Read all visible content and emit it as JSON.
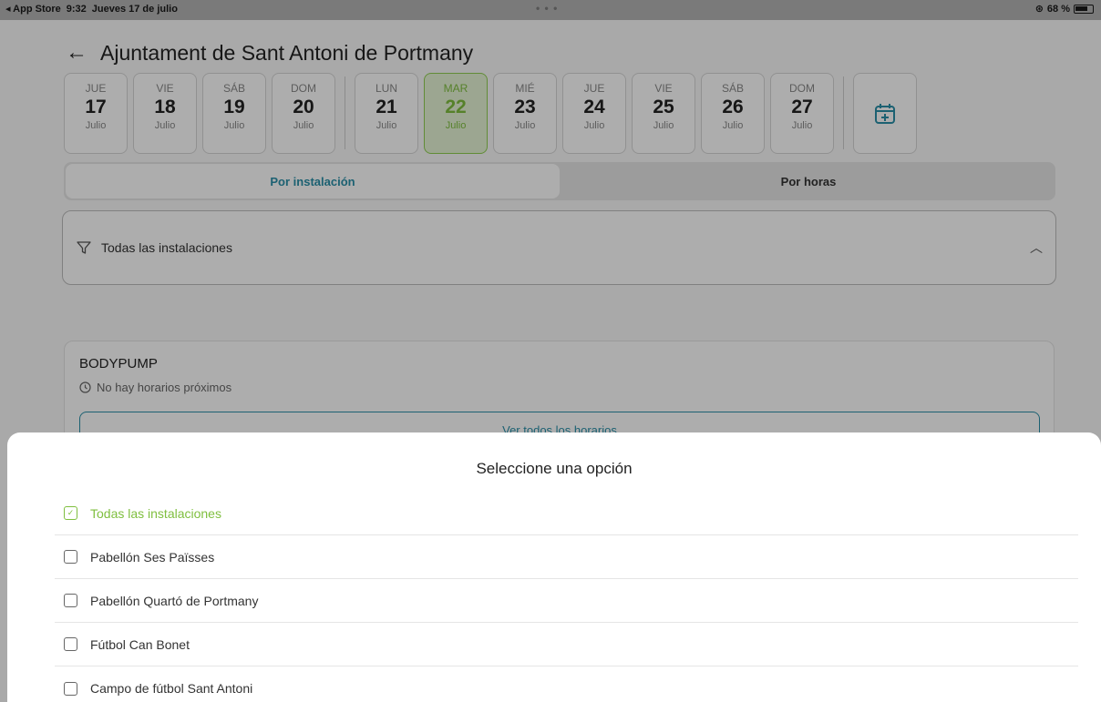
{
  "status_bar": {
    "back_app": "◂ App Store",
    "time": "9:32",
    "date": "Jueves 17 de julio",
    "battery": "68 %"
  },
  "header": {
    "title": "Ajuntament de Sant Antoni de Portmany"
  },
  "days_group1": [
    {
      "weekday": "JUE",
      "day": "17",
      "month": "Julio"
    },
    {
      "weekday": "VIE",
      "day": "18",
      "month": "Julio"
    },
    {
      "weekday": "SÁB",
      "day": "19",
      "month": "Julio"
    },
    {
      "weekday": "DOM",
      "day": "20",
      "month": "Julio"
    }
  ],
  "days_group2": [
    {
      "weekday": "LUN",
      "day": "21",
      "month": "Julio"
    },
    {
      "weekday": "MAR",
      "day": "22",
      "month": "Julio",
      "selected": true
    },
    {
      "weekday": "MIÉ",
      "day": "23",
      "month": "Julio"
    },
    {
      "weekday": "JUE",
      "day": "24",
      "month": "Julio"
    },
    {
      "weekday": "VIE",
      "day": "25",
      "month": "Julio"
    },
    {
      "weekday": "SÁB",
      "day": "26",
      "month": "Julio"
    },
    {
      "weekday": "DOM",
      "day": "27",
      "month": "Julio"
    }
  ],
  "tabs": {
    "by_facility": "Por instalación",
    "by_hours": "Por horas"
  },
  "filter": {
    "label": "Todas las instalaciones"
  },
  "card": {
    "name": "BODYPUMP",
    "schedule_note": "No hay horarios próximos",
    "see_all": "Ver todos los horarios"
  },
  "sheet": {
    "title": "Seleccione una opción",
    "options": [
      {
        "label": "Todas las instalaciones",
        "checked": true
      },
      {
        "label": "Pabellón Ses Païsses",
        "checked": false
      },
      {
        "label": "Pabellón Quartó de Portmany",
        "checked": false
      },
      {
        "label": "Fútbol Can Bonet",
        "checked": false
      },
      {
        "label": "Campo de fútbol Sant Antoni",
        "checked": false
      }
    ]
  },
  "colors": {
    "accent_green": "#7fbf3f",
    "accent_teal": "#2a8fa8"
  }
}
